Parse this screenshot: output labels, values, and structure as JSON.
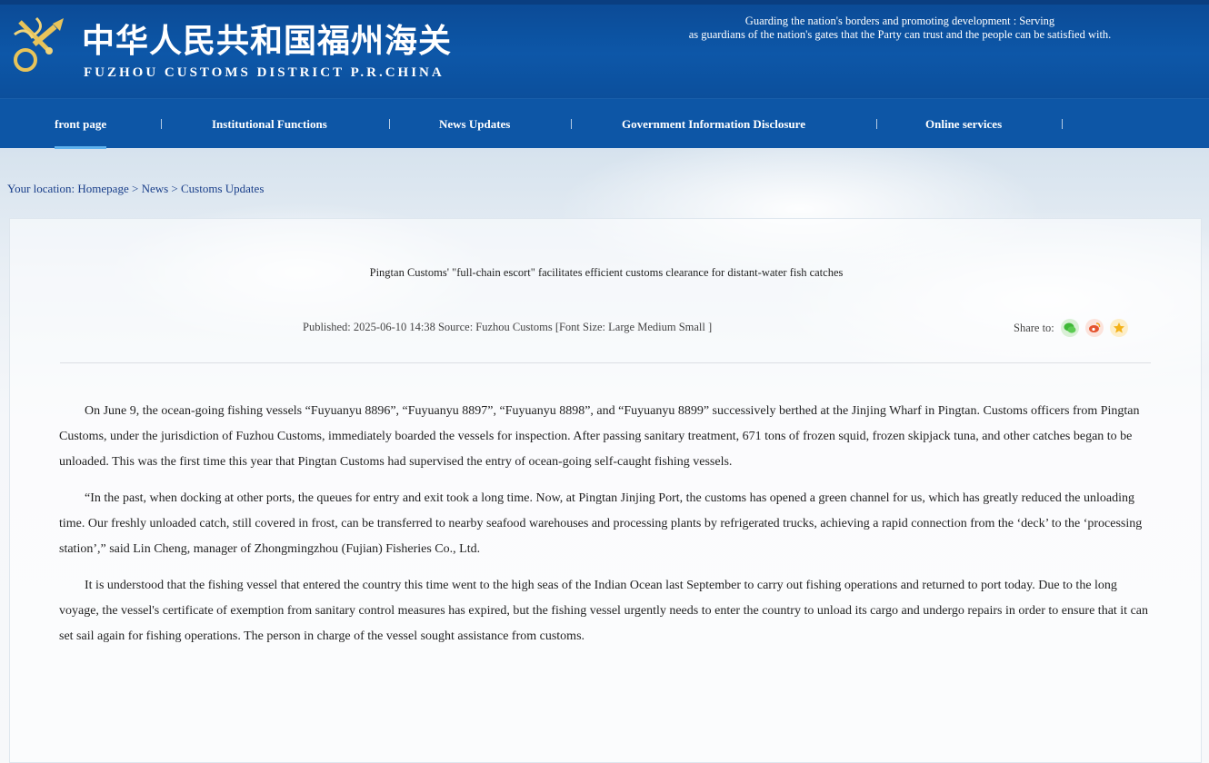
{
  "header": {
    "title_cn": "中华人民共和国福州海关",
    "title_en": "FUZHOU CUSTOMS DISTRICT P.R.CHINA",
    "slogan_line1": "Guarding the nation's borders and promoting development : Serving",
    "slogan_line2": "as guardians of the nation's gates that the Party can trust and the people can be satisfied with.",
    "logo_icon": "customs-emblem-icon"
  },
  "nav": {
    "items": [
      {
        "label": "front page"
      },
      {
        "label": "Institutional Functions"
      },
      {
        "label": "News Updates"
      },
      {
        "label": "Government Information Disclosure"
      },
      {
        "label": "Online services"
      }
    ],
    "active": "front page",
    "separator": "|"
  },
  "breadcrumb": {
    "prefix": "Your location:",
    "items": [
      "Homepage",
      "News",
      "Customs Updates"
    ],
    "separator": ">"
  },
  "article": {
    "title": "Pingtan Customs' \"full-chain escort\" facilitates efficient customs clearance for distant-water fish catches",
    "published_label": "Published:",
    "published_value": "2025-06-10 14:38",
    "source_label": "Source:",
    "source_value": "Fuzhou Customs",
    "font_size_label": "[Font Size:",
    "font_large": "Large",
    "font_medium": "Medium",
    "font_small": "Small",
    "font_close": "]",
    "share_label": "Share to:",
    "share_icons": [
      "wechat-icon",
      "weibo-icon",
      "favorite-icon"
    ],
    "paragraphs": [
      "On June 9, the ocean-going fishing vessels “Fuyuanyu 8896”, “Fuyuanyu 8897”, “Fuyuanyu 8898”, and “Fuyuanyu 8899” successively berthed at the Jinjing Wharf in Pingtan. Customs officers from Pingtan Customs, under the jurisdiction of Fuzhou Customs, immediately boarded the vessels for inspection. After passing sanitary treatment, 671 tons of frozen squid, frozen skipjack tuna, and other catches began to be unloaded. This was the first time this year that Pingtan Customs had supervised the entry of ocean-going self-caught fishing vessels.",
      "“In the past, when docking at other ports, the queues for entry and exit took a long time. Now, at Pingtan Jinjing Port, the customs has opened a green channel for us, which has greatly reduced the unloading time. Our freshly unloaded catch, still covered in frost, can be transferred to nearby seafood warehouses and processing plants by refrigerated trucks, achieving a rapid connection from the ‘deck’ to the ‘processing station’,” said Lin Cheng, manager of Zhongmingzhou (Fujian) Fisheries Co., Ltd.",
      "It is understood that the fishing vessel that entered the country this time went to the high seas of the Indian Ocean last September to carry out fishing operations and returned to port today. Due to the long voyage, the vessel's certificate of exemption from sanitary control measures has expired, but the fishing vessel urgently needs to enter the country to unload its cargo and undergo repairs in order to ensure that it can set sail again for fishing operations. The person in charge of the vessel sought assistance from customs."
    ]
  },
  "colors": {
    "header_bg": "#0c4f9c",
    "nav_bg": "#0d56a6",
    "nav_active_underline": "#5fb2ee",
    "link": "#1a3f8a"
  }
}
